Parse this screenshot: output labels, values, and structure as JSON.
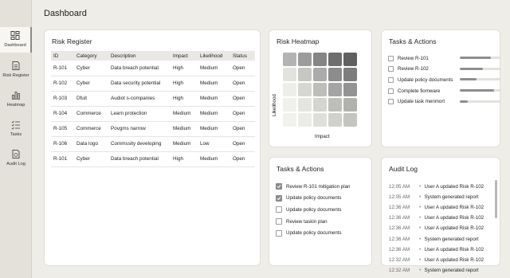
{
  "page_title": "Dashboard",
  "sidebar": {
    "items": [
      {
        "label": "Dashboard",
        "icon": "dashboard-icon",
        "active": true
      },
      {
        "label": "Risk Register",
        "icon": "document-icon",
        "active": false
      },
      {
        "label": "Heatmap",
        "icon": "bar-chart-icon",
        "active": false
      },
      {
        "label": "Tasks",
        "icon": "checklist-icon",
        "active": false
      },
      {
        "label": "Audit Log",
        "icon": "log-icon",
        "active": false
      }
    ]
  },
  "risk_register": {
    "title": "Risk Register",
    "columns": [
      "ID",
      "Category",
      "Description",
      "Impact",
      "Likelihood",
      "Status"
    ],
    "rows": [
      [
        "R-101",
        "Cyber",
        "Data breach potential",
        "High",
        "Medium",
        "Open"
      ],
      [
        "R-102",
        "Cyber",
        "Data security potential",
        "High",
        "Medium",
        "Open"
      ],
      [
        "R-103",
        "Dfuit",
        "Audiot s-companies",
        "High",
        "Medium",
        "Open"
      ],
      [
        "R-104",
        "Commerce",
        "Learn protection",
        "Medium",
        "Medium",
        "Open"
      ],
      [
        "R-105",
        "Commerce",
        "Povgms narrow",
        "Medium",
        "Medium",
        "Open"
      ],
      [
        "R-106",
        "Data logo",
        "Commssity developing",
        "Medium",
        "Low",
        "Open"
      ],
      [
        "R-101",
        "Cyber",
        "Data breach potential",
        "High",
        "Medium",
        "Open"
      ]
    ]
  },
  "heatmap": {
    "title": "Risk Heatmap",
    "x_label": "Impact",
    "y_label": "Likelihood",
    "colors": [
      [
        "#b3b3b3",
        "#9c9c9c",
        "#858585",
        "#6e6e6e",
        "#606060"
      ],
      [
        "#e3e3de",
        "#c6c6c2",
        "#ababab",
        "#8c8c8c",
        "#7d7d7d"
      ],
      [
        "#ededea",
        "#d6d6d2",
        "#bdbdba",
        "#a4a4a4",
        "#939393"
      ],
      [
        "#f0f0ed",
        "#e4e4e0",
        "#d4d4d0",
        "#bdbdba",
        "#b1b1ae"
      ],
      [
        "#f1f1ee",
        "#ebebe7",
        "#dededa",
        "#d0d0cc",
        "#c4c4c0"
      ]
    ]
  },
  "tasks_top": {
    "title": "Tasks & Actions",
    "items": [
      {
        "label": "Review R-101",
        "progress": 0.75
      },
      {
        "label": "Review R-102",
        "progress": 0.55
      },
      {
        "label": "Update policy documents",
        "progress": 0.4
      },
      {
        "label": "Complete fiomware",
        "progress": 0.82
      },
      {
        "label": "Update task menmort",
        "progress": 0.2
      }
    ]
  },
  "tasks_bottom": {
    "title": "Tasks & Actions",
    "items": [
      {
        "label": "Review R-101 mitigation plan",
        "checked": true
      },
      {
        "label": "Update policy documents",
        "checked": true
      },
      {
        "label": "Update policy documents",
        "checked": false
      },
      {
        "label": "Review taskin plan",
        "checked": false
      },
      {
        "label": "Update policy documents",
        "checked": false
      }
    ]
  },
  "audit_log": {
    "title": "Audit Log",
    "entries": [
      {
        "time": "12:05 AM",
        "text": "User A updated Risk R-102"
      },
      {
        "time": "12:05 AM",
        "text": "System generated report"
      },
      {
        "time": "12:36 AM",
        "text": "User A updated Risk R-102"
      },
      {
        "time": "12:36 AM",
        "text": "User A updated Risk R-102"
      },
      {
        "time": "12:36 AM",
        "text": "User A updated Risk R-102"
      },
      {
        "time": "12:36 AM",
        "text": "System generated report"
      },
      {
        "time": "12:36 AM",
        "text": "User A updated Risk R-102"
      },
      {
        "time": "12:32 AM",
        "text": "User A updated Risk R-102"
      },
      {
        "time": "12:32 AM",
        "text": "System generated report"
      }
    ]
  }
}
